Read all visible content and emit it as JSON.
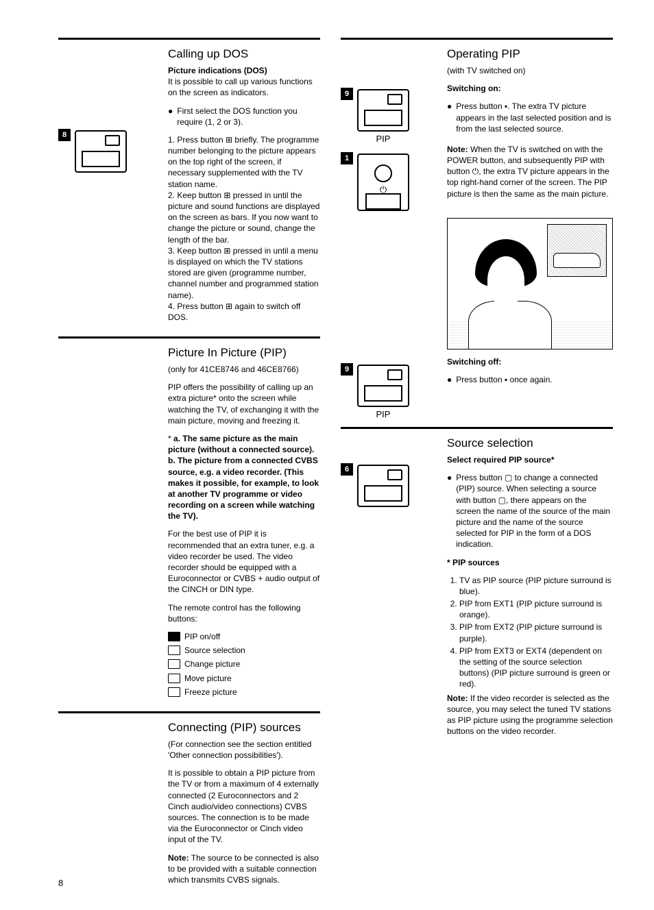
{
  "page_number": "8",
  "left": {
    "sec1": {
      "title": "Calling up DOS",
      "sub_bold": "Picture indications (DOS)",
      "intro": "It is possible to call up various functions on the screen as indicators.",
      "bullet": "First select the DOS function you require (1, 2 or 3).",
      "badge": "8",
      "steps": "1. Press button ⊞ briefly. The programme number belonging to the picture appears on the top right of the screen, if necessary supplemented with the TV station name.\n2. Keep button ⊞ pressed in until the picture and sound functions are displayed on the screen as bars. If you now want to change the picture or sound, change the length of the bar.\n3. Keep button ⊞ pressed in until a menu is displayed on which the TV stations stored are given (programme number, channel number and programmed station name).\n4. Press button ⊞ again to switch off DOS."
    },
    "sec2": {
      "title": "Picture In Picture (PIP)",
      "sub": "(only for 41CE8746 and 46CE8766)",
      "p1": "PIP offers the possibility of calling up an extra picture* onto the screen while watching the TV, of exchanging it with the main picture, moving and freezing it.",
      "note_a": "a. The same picture as the main picture (without a connected source).",
      "note_b": "b. The picture from a connected CVBS source, e.g. a video recorder. (This makes it possible, for example, to look at another TV programme or video recording on a screen while watching the TV).",
      "p2": "For the best use of PIP it is recommended that an extra tuner, e.g. a video recorder be used. The video recorder should be equipped with a Euroconnector or CVBS + audio output of the CINCH or DIN type.",
      "p3": "The remote control has the following buttons:",
      "b1": "PIP on/off",
      "b2": "Source selection",
      "b3": "Change picture",
      "b4": "Move picture",
      "b5": "Freeze picture"
    },
    "sec3": {
      "title": "Connecting (PIP) sources",
      "p1": "(For connection see the section entitled 'Other connection possibilities').",
      "p2": "It is possible to obtain a PIP picture from the TV or from a maximum of 4 externally connected (2 Euroconnectors and 2 Cinch audio/video connections) CVBS sources. The connection is to be made via the Euroconnector or Cinch video input of the TV.",
      "note_lbl": "Note:",
      "note": " The source to be connected is also to be provided with a suitable connection which transmits CVBS signals."
    }
  },
  "right": {
    "sec1": {
      "title": "Operating PIP",
      "sub": "(with TV switched on)",
      "sw_on": "Switching on:",
      "sw_on_text": "Press button ▪. The extra TV picture appears in the last selected position and is from the last selected source.",
      "badge9": "9",
      "pip_label": "PIP",
      "badge1": "1",
      "power_sym": "⏻",
      "note_lbl": "Note:",
      "note": " When the TV is switched on with the POWER button, and subsequently PIP with button ⏻, the extra TV picture appears in the top right-hand corner of the screen. The PIP picture is then the same as the main picture.",
      "sw_off": "Switching off:",
      "sw_off_text": "Press button ▪ once again."
    },
    "sec2": {
      "title": "Source selection",
      "sub_bold": "Select required PIP source*",
      "badge6": "6",
      "bullet": "Press button ▢ to change a connected (PIP) source. When selecting a source with button ▢, there appears on the screen the name of the source of the main picture and the name of the source selected for PIP in the form of a DOS indication.",
      "src_lbl": "* PIP sources",
      "s1": "TV as PIP source (PIP picture surround is blue).",
      "s2": "PIP from EXT1 (PIP picture surround is orange).",
      "s3": "PIP from EXT2 (PIP picture surround is purple).",
      "s4": "PIP from EXT3 or EXT4 (dependent on the setting of the source selection buttons) (PIP picture surround is green or red).",
      "note_lbl": "Note:",
      "note": " If the video recorder is selected as the source, you may select the tuned TV stations as PIP picture using the programme selection buttons on the video recorder."
    }
  }
}
